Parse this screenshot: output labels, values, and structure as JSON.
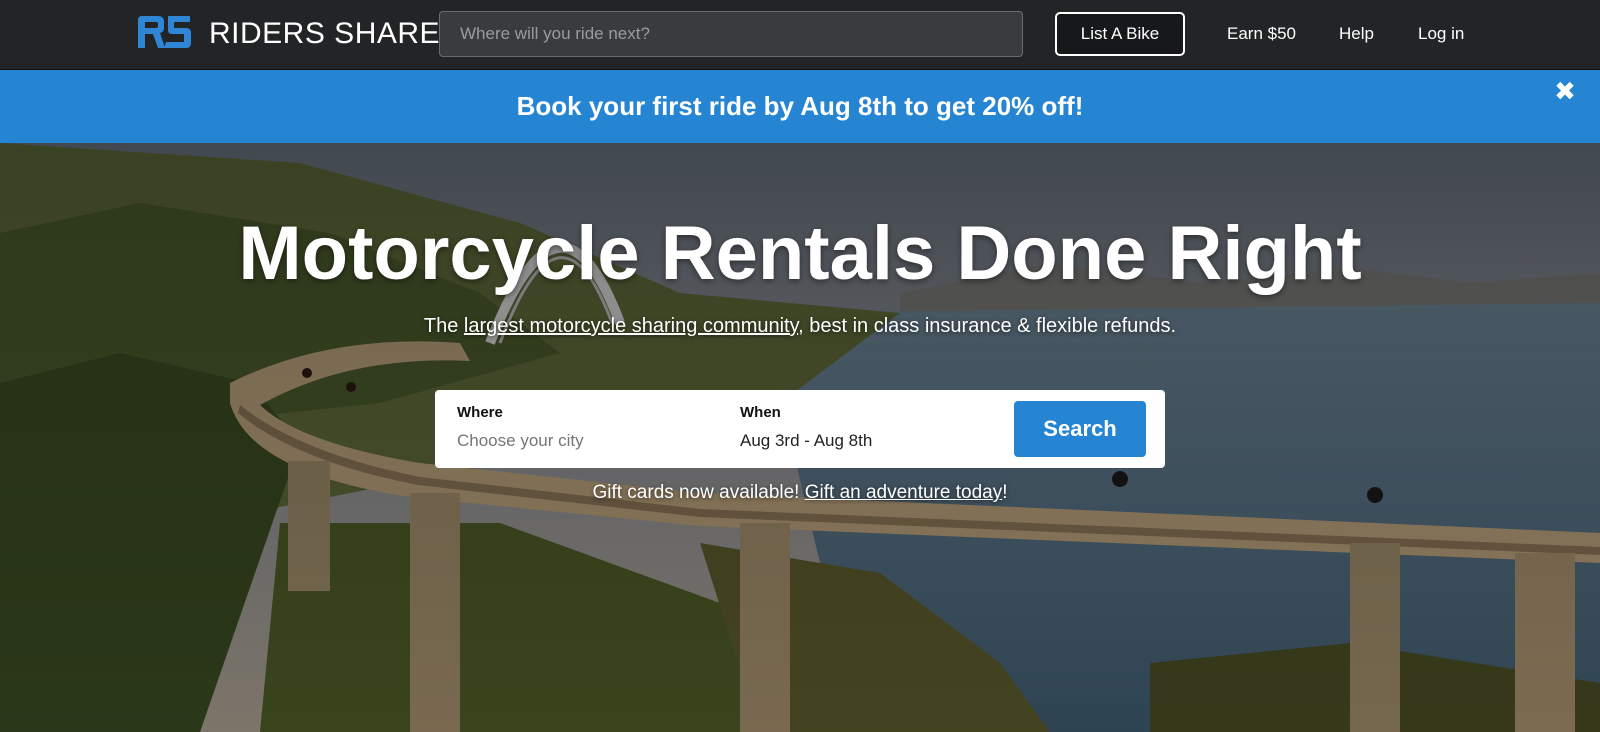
{
  "header": {
    "brand": "RIDERS SHARE",
    "search_placeholder": "Where will you ride next?",
    "list_bike_label": "List A Bike",
    "earn_label": "Earn $50",
    "help_label": "Help",
    "login_label": "Log in"
  },
  "promo": {
    "text": "Book your first ride by Aug 8th to get 20% off!",
    "close_symbol": "✖"
  },
  "hero": {
    "title": "Motorcycle Rentals Done Right",
    "subtitle_prefix": "The ",
    "subtitle_link": "largest motorcycle sharing community",
    "subtitle_suffix": ", best in class insurance & flexible refunds.",
    "gift_prefix": "Gift cards now available! ",
    "gift_link": "Gift an adventure today",
    "gift_suffix": "!"
  },
  "search": {
    "where_label": "Where",
    "where_placeholder": "Choose your city",
    "when_label": "When",
    "when_value": "Aug 3rd - Aug 8th",
    "button_label": "Search"
  },
  "colors": {
    "nav_bg": "#222426",
    "accent_blue": "#2585d3",
    "white": "#ffffff"
  },
  "icons": {
    "logo": "riders-share-logo-icon",
    "close": "close-icon"
  }
}
